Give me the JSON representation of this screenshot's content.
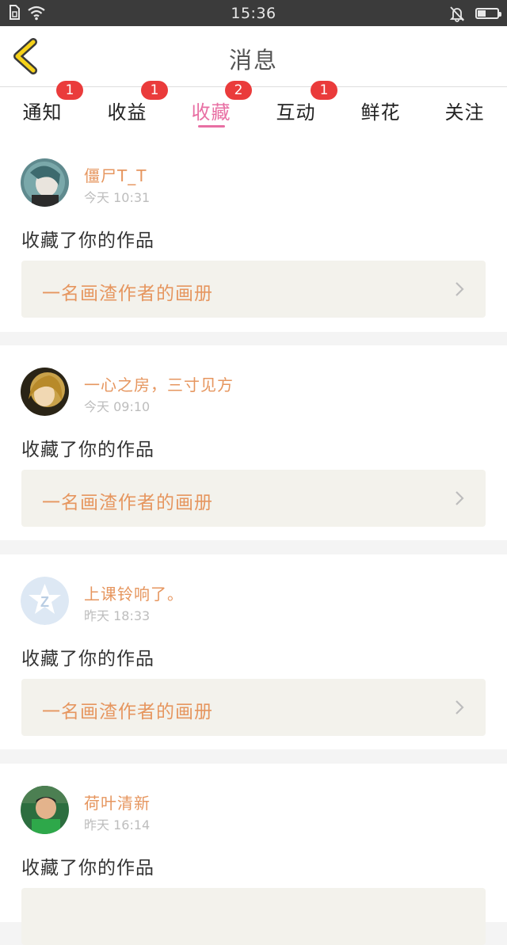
{
  "status_bar": {
    "time": "15:36",
    "battery_level": 0.4
  },
  "header": {
    "title": "消息"
  },
  "tabs": [
    {
      "label": "通知",
      "badge": "1"
    },
    {
      "label": "收益",
      "badge": "1"
    },
    {
      "label": "收藏",
      "badge": "2",
      "active": true
    },
    {
      "label": "互动",
      "badge": "1"
    },
    {
      "label": "鲜花",
      "badge": ""
    },
    {
      "label": "关注",
      "badge": ""
    }
  ],
  "colors": {
    "accent_pink": "#e86fa3",
    "badge_red": "#ea3b3b",
    "name_orange": "#e6965f"
  },
  "feed": [
    {
      "name": "僵尸T_T",
      "time": "今天 10:31",
      "message": "收藏了你的作品",
      "work_title": "一名画渣作者的画册"
    },
    {
      "name": "一心之房，三寸见方",
      "time": "今天 09:10",
      "message": "收藏了你的作品",
      "work_title": "一名画渣作者的画册"
    },
    {
      "name": "上课铃响了。",
      "time": "昨天 18:33",
      "message": "收藏了你的作品",
      "work_title": "一名画渣作者的画册"
    },
    {
      "name": "荷叶清新",
      "time": "昨天 16:14",
      "message": "收藏了你的作品",
      "work_title": ""
    }
  ]
}
